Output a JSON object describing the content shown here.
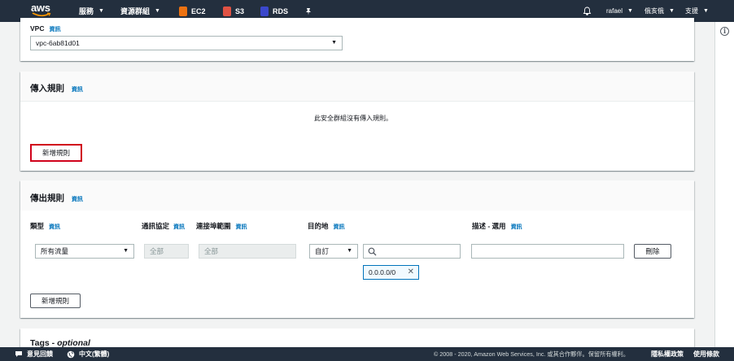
{
  "topnav": {
    "brand": "aws",
    "services_label": "服務",
    "resource_groups_label": "資源群組",
    "favorites": [
      {
        "label": "EC2",
        "color": "#ec7211"
      },
      {
        "label": "S3",
        "color": "#e05243"
      },
      {
        "label": "RDS",
        "color": "#3b48cc"
      }
    ],
    "user_label": "rafael",
    "region_label": "俄亥俄",
    "support_label": "支援"
  },
  "vpc": {
    "label": "VPC",
    "info": "資訊",
    "value": "vpc-6ab81d01"
  },
  "inbound": {
    "title": "傳入規則",
    "info": "資訊",
    "empty_message": "此安全群組沒有傳入規則。",
    "add_rule_label": "新增規則"
  },
  "outbound": {
    "title": "傳出規則",
    "info": "資訊",
    "columns": {
      "type": "類型",
      "protocol": "通訊協定",
      "port_range": "連接埠範圍",
      "destination": "目的地",
      "description": "描述 - 選用"
    },
    "row": {
      "type_value": "所有流量",
      "protocol_value": "全部",
      "port_value": "全部",
      "destination_mode": "自訂",
      "destination_search": "",
      "destination_token": "0.0.0.0/0",
      "description_value": "",
      "delete_label": "刪除"
    },
    "add_rule_label": "新增規則"
  },
  "tags": {
    "title": "Tags - optional"
  },
  "footer": {
    "feedback_label": "意見回饋",
    "language_label": "中文(繁體)",
    "copyright": "© 2008 - 2020, Amazon Web Services, Inc. 或其合作夥伴。保留所有權利。",
    "privacy_label": "隱私權政策",
    "terms_label": "使用條款"
  },
  "colors": {
    "nav_bg": "#232f3e",
    "link": "#0073bb",
    "highlight": "#d0021b"
  }
}
